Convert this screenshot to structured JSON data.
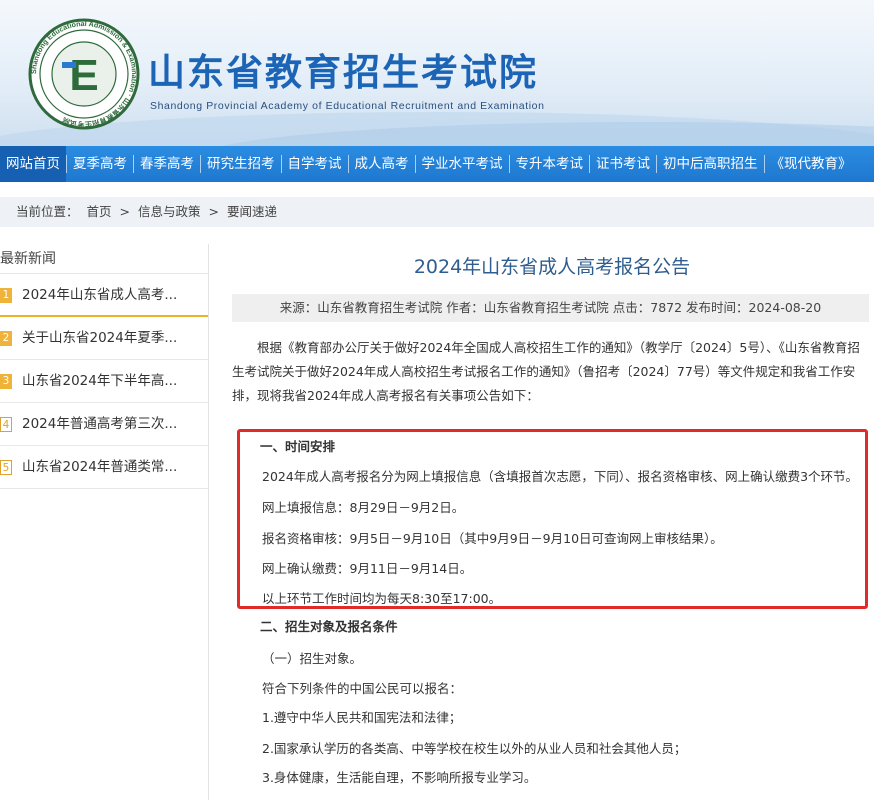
{
  "header": {
    "seal_text": "Shandong Educational Admission & Examination · 山东省教育招生考试院",
    "seal_letter": "E",
    "title": "山东省教育招生考试院",
    "subtitle": "Shandong Provincial Academy of Educational Recruitment and Examination"
  },
  "nav": {
    "items": [
      "网站首页",
      "夏季高考",
      "春季高考",
      "研究生招考",
      "自学考试",
      "成人高考",
      "学业水平考试",
      "专升本考试",
      "证书考试",
      "初中后高职招生",
      "《现代教育》"
    ]
  },
  "breadcrumb": {
    "label": "当前位置：",
    "home": "首页",
    "sep": ">",
    "level2": "信息与政策",
    "level3": "要闻速递"
  },
  "sidebar": {
    "heading": "最新新闻",
    "items": [
      {
        "num": "1",
        "text": "2024年山东省成人高考..."
      },
      {
        "num": "2",
        "text": "关于山东省2024年夏季..."
      },
      {
        "num": "3",
        "text": "山东省2024年下半年高..."
      },
      {
        "num": "4",
        "text": "2024年普通高考第三次..."
      },
      {
        "num": "5",
        "text": "山东省2024年普通类常..."
      }
    ]
  },
  "article": {
    "title": "2024年山东省成人高考报名公告",
    "meta": "来源：山东省教育招生考试院 作者：山东省教育招生考试院 点击：7872 发布时间：2024-08-20",
    "intro": "根据《教育部办公厅关于做好2024年全国成人高校招生工作的通知》（教学厅〔2024〕5号）、《山东省教育招生考试院关于做好2024年成人高校招生考试报名工作的通知》（鲁招考〔2024〕77号）等文件规定和我省工作安排，现将我省2024年成人高考报名有关事项公告如下：",
    "section1_title": "一、时间安排",
    "section1_lines": [
      "2024年成人高考报名分为网上填报信息（含填报首次志愿，下同）、报名资格审核、网上确认缴费3个环节。",
      "网上填报信息：8月29日－9月2日。",
      "报名资格审核：9月5日－9月10日（其中9月9日－9月10日可查询网上审核结果）。",
      "网上确认缴费：9月11日－9月14日。",
      "以上环节工作时间均为每天8:30至17:00。"
    ],
    "section2_title": "二、招生对象及报名条件",
    "section2_lines": [
      "（一）招生对象。",
      "符合下列条件的中国公民可以报名：",
      "1.遵守中华人民共和国宪法和法律；",
      "2.国家承认学历的各类高、中等学校在校生以外的从业人员和社会其他人员；",
      "3.身体健康，生活能自理，不影响所报专业学习。"
    ]
  },
  "colors": {
    "nav": "#1f77cf",
    "title_blue": "#1b64b6",
    "highlight_red": "#e12b2b",
    "sidebar_badge": "#f0b33a"
  }
}
